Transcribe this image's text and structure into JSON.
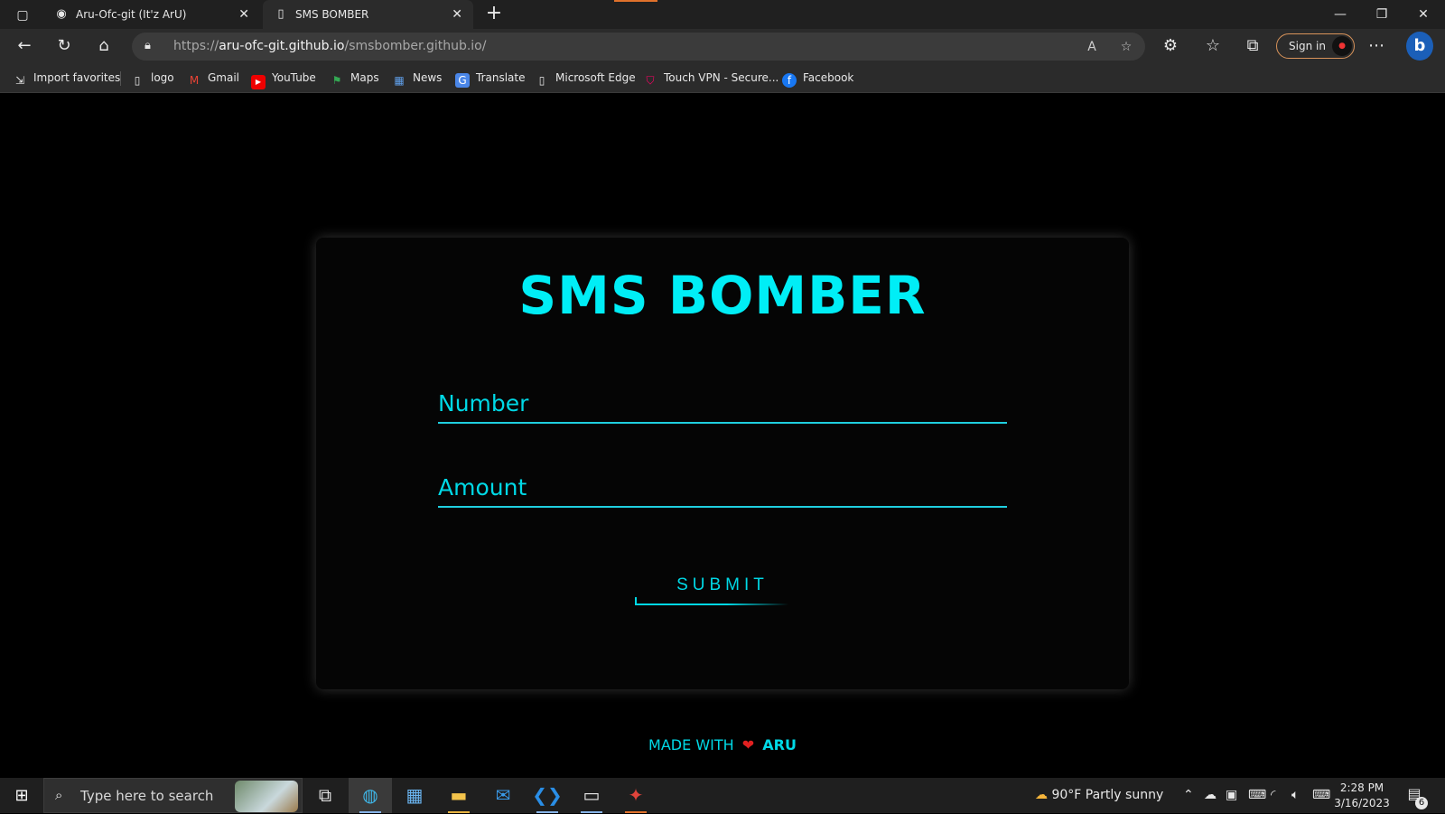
{
  "browser": {
    "tabs": [
      {
        "title": "Aru-Ofc-git (It'z ArU)",
        "icon": "github-icon",
        "active": false
      },
      {
        "title": "SMS BOMBER",
        "icon": "page-icon",
        "active": true
      }
    ],
    "url_prefix": "https://",
    "url_domain": "aru-ofc-git.github.io",
    "url_path": "/smsbomber.github.io/",
    "sign_in_label": "Sign in",
    "favorites": [
      {
        "label": "Import favorites",
        "icon": "import-icon"
      },
      {
        "label": "logo",
        "icon": "page-icon"
      },
      {
        "label": "Gmail",
        "icon": "gmail-icon"
      },
      {
        "label": "YouTube",
        "icon": "youtube-icon"
      },
      {
        "label": "Maps",
        "icon": "maps-icon"
      },
      {
        "label": "News",
        "icon": "news-icon"
      },
      {
        "label": "Translate",
        "icon": "translate-icon"
      },
      {
        "label": "Microsoft Edge",
        "icon": "page-icon"
      },
      {
        "label": "Touch VPN - Secure...",
        "icon": "vpn-icon"
      },
      {
        "label": "Facebook",
        "icon": "facebook-icon"
      }
    ]
  },
  "page": {
    "title": "SMS BOMBER",
    "number_placeholder": "Number",
    "amount_placeholder": "Amount",
    "submit_label": "SUBMIT",
    "footer_prefix": "MADE WITH",
    "footer_author": "ARU",
    "accent_color": "#00eef6"
  },
  "taskbar": {
    "search_placeholder": "Type here to search",
    "weather": "90°F  Partly sunny",
    "time": "2:28 PM",
    "date": "3/16/2023",
    "notification_count": "6"
  }
}
